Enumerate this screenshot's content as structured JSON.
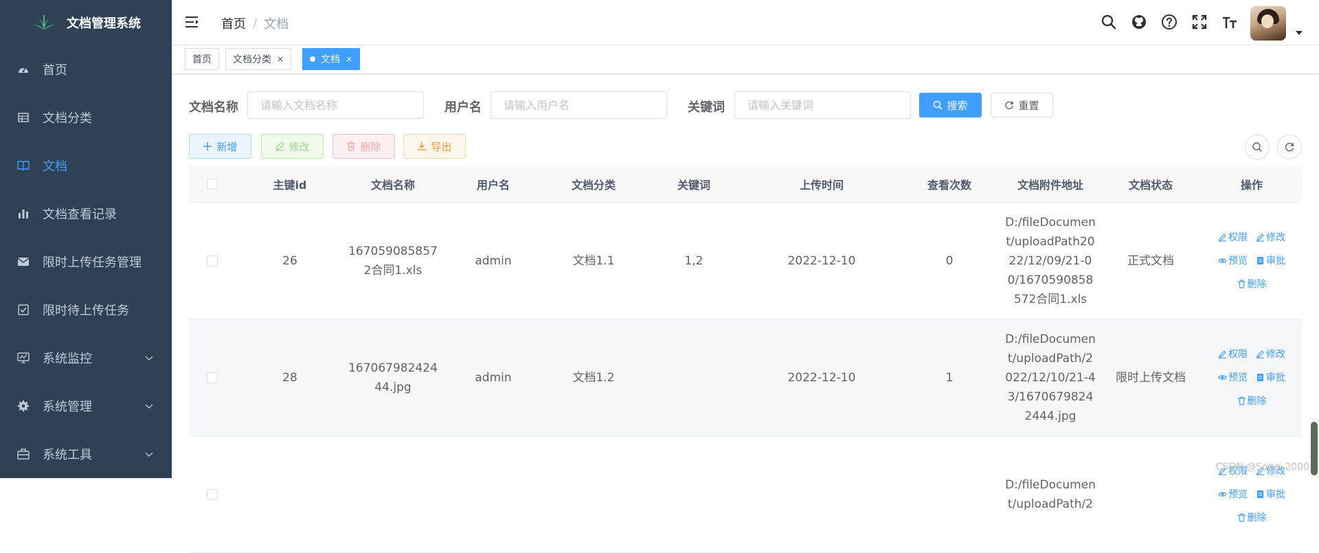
{
  "app": {
    "title": "文档管理系统"
  },
  "sidebar": {
    "items": [
      {
        "label": "首页",
        "icon": "dashboard-icon"
      },
      {
        "label": "文档分类",
        "icon": "table-icon"
      },
      {
        "label": "文档",
        "icon": "book-icon",
        "active": true
      },
      {
        "label": "文档查看记录",
        "icon": "chart-icon"
      },
      {
        "label": "限时上传任务管理",
        "icon": "message-icon"
      },
      {
        "label": "限时待上传任务",
        "icon": "checkbox-icon"
      },
      {
        "label": "系统监控",
        "icon": "monitor-icon",
        "expandable": true
      },
      {
        "label": "系统管理",
        "icon": "gear-icon",
        "expandable": true
      },
      {
        "label": "系统工具",
        "icon": "toolbox-icon",
        "expandable": true
      }
    ]
  },
  "breadcrumb": {
    "home": "首页",
    "sep": "/",
    "current": "文档"
  },
  "tags": [
    {
      "label": "首页",
      "closable": false
    },
    {
      "label": "文档分类",
      "closable": true,
      "close": "×"
    },
    {
      "label": "文档",
      "closable": true,
      "close": "×",
      "active": true
    }
  ],
  "search": {
    "doc_name_label": "文档名称",
    "doc_name_placeholder": "请输入文档名称",
    "username_label": "用户名",
    "username_placeholder": "请输入用户名",
    "keyword_label": "关键词",
    "keyword_placeholder": "请输入关键词",
    "search_button": "搜索",
    "reset_button": "重置"
  },
  "toolbar": {
    "add": "新增",
    "edit": "修改",
    "delete": "删除",
    "export": "导出"
  },
  "table": {
    "headers": [
      "主键id",
      "文档名称",
      "用户名",
      "文档分类",
      "关键词",
      "上传时间",
      "查看次数",
      "文档附件地址",
      "文档状态",
      "操作"
    ],
    "rows": [
      {
        "id": "26",
        "name": "1670590858572合同1.xls",
        "user": "admin",
        "category": "文档1.1",
        "keywords": "1,2",
        "upload_time": "2022-12-10",
        "views": "0",
        "path": "D:/fileDocument/uploadPath2022/12/09/21-00/1670590858572合同1.xls",
        "status": "正式文档"
      },
      {
        "id": "28",
        "name": "167067982424 44.jpg",
        "user": "admin",
        "category": "文档1.2",
        "keywords": "",
        "upload_time": "2022-12-10",
        "views": "1",
        "path": "D:/fileDocument/uploadPath/2022/12/10/21-43/16706798242444.jpg",
        "status": "限时上传文档"
      },
      {
        "id": "",
        "name": "",
        "user": "",
        "category": "",
        "keywords": "",
        "upload_time": "",
        "views": "",
        "path": "D:/fileDocument/uploadPath/2",
        "status": ""
      }
    ],
    "ops": {
      "permission": "权限",
      "edit": "修改",
      "preview": "预览",
      "approve": "审批",
      "delete": "删除"
    }
  },
  "watermark": "CSDN @Song_2000",
  "colors": {
    "sidebar_bg": "#304156",
    "accent": "#409eff",
    "sidebar_text": "#bfcbd9"
  }
}
